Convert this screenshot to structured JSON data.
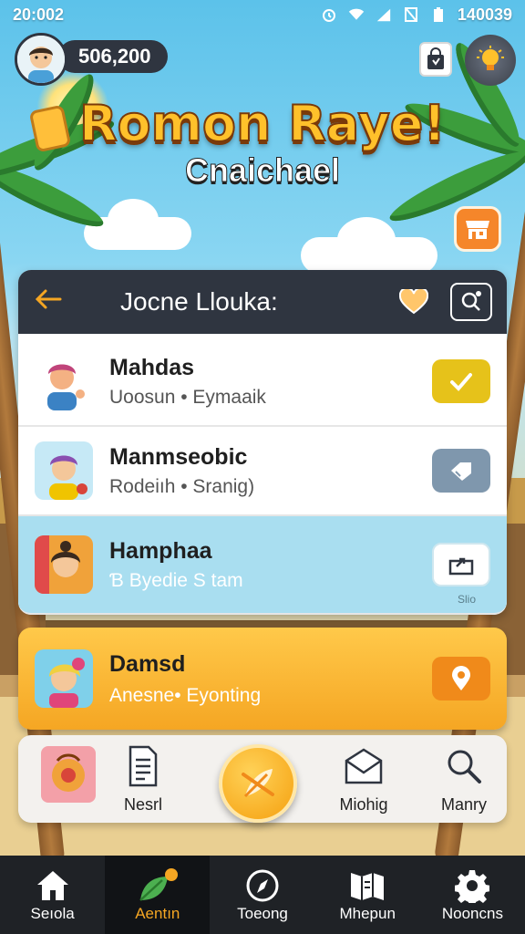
{
  "status_bar": {
    "time": "20:002",
    "right_text": "140039"
  },
  "hud": {
    "balance": "506,200"
  },
  "title": "Romon Raye!",
  "subtitle": "Cnaichael",
  "panel": {
    "title": "Jocne Llouka:"
  },
  "rows": [
    {
      "name": "Mahdas",
      "sub": "Uoosun • Eymaaik",
      "action_icon": "check-icon",
      "action_color": "#e6c21a"
    },
    {
      "name": "Manmseobic",
      "sub": "Rodeiıh • Sranig)",
      "action_icon": "tag-icon",
      "action_color": "#7f97ad"
    },
    {
      "name": "Hamphaa",
      "sub": "Ɓ Byedie S tam",
      "action_icon": "share-icon",
      "action_color": "#ffffff",
      "tag": "Slio"
    }
  ],
  "selected_card": {
    "name": "Damsd",
    "sub": "Anesne• Eyonting",
    "action_icon": "pin-icon"
  },
  "quick_actions": [
    {
      "label": "",
      "icon": "gift-icon"
    },
    {
      "label": "Nesrl",
      "icon": "document-icon"
    },
    {
      "label": "Miohig",
      "icon": "mail-icon"
    },
    {
      "label": "Manry",
      "icon": "search-icon"
    }
  ],
  "bottom_nav": [
    {
      "label": "Seıola",
      "icon": "home-icon"
    },
    {
      "label": "Aentın",
      "icon": "leaf-icon"
    },
    {
      "label": "Toeong",
      "icon": "compass-icon"
    },
    {
      "label": "Mhepun",
      "icon": "map-icon"
    },
    {
      "label": "Nooncns",
      "icon": "gear-icon"
    }
  ],
  "colors": {
    "accent": "#f5a623",
    "header_dark": "#2f3540",
    "highlight_row": "#a9def0"
  }
}
